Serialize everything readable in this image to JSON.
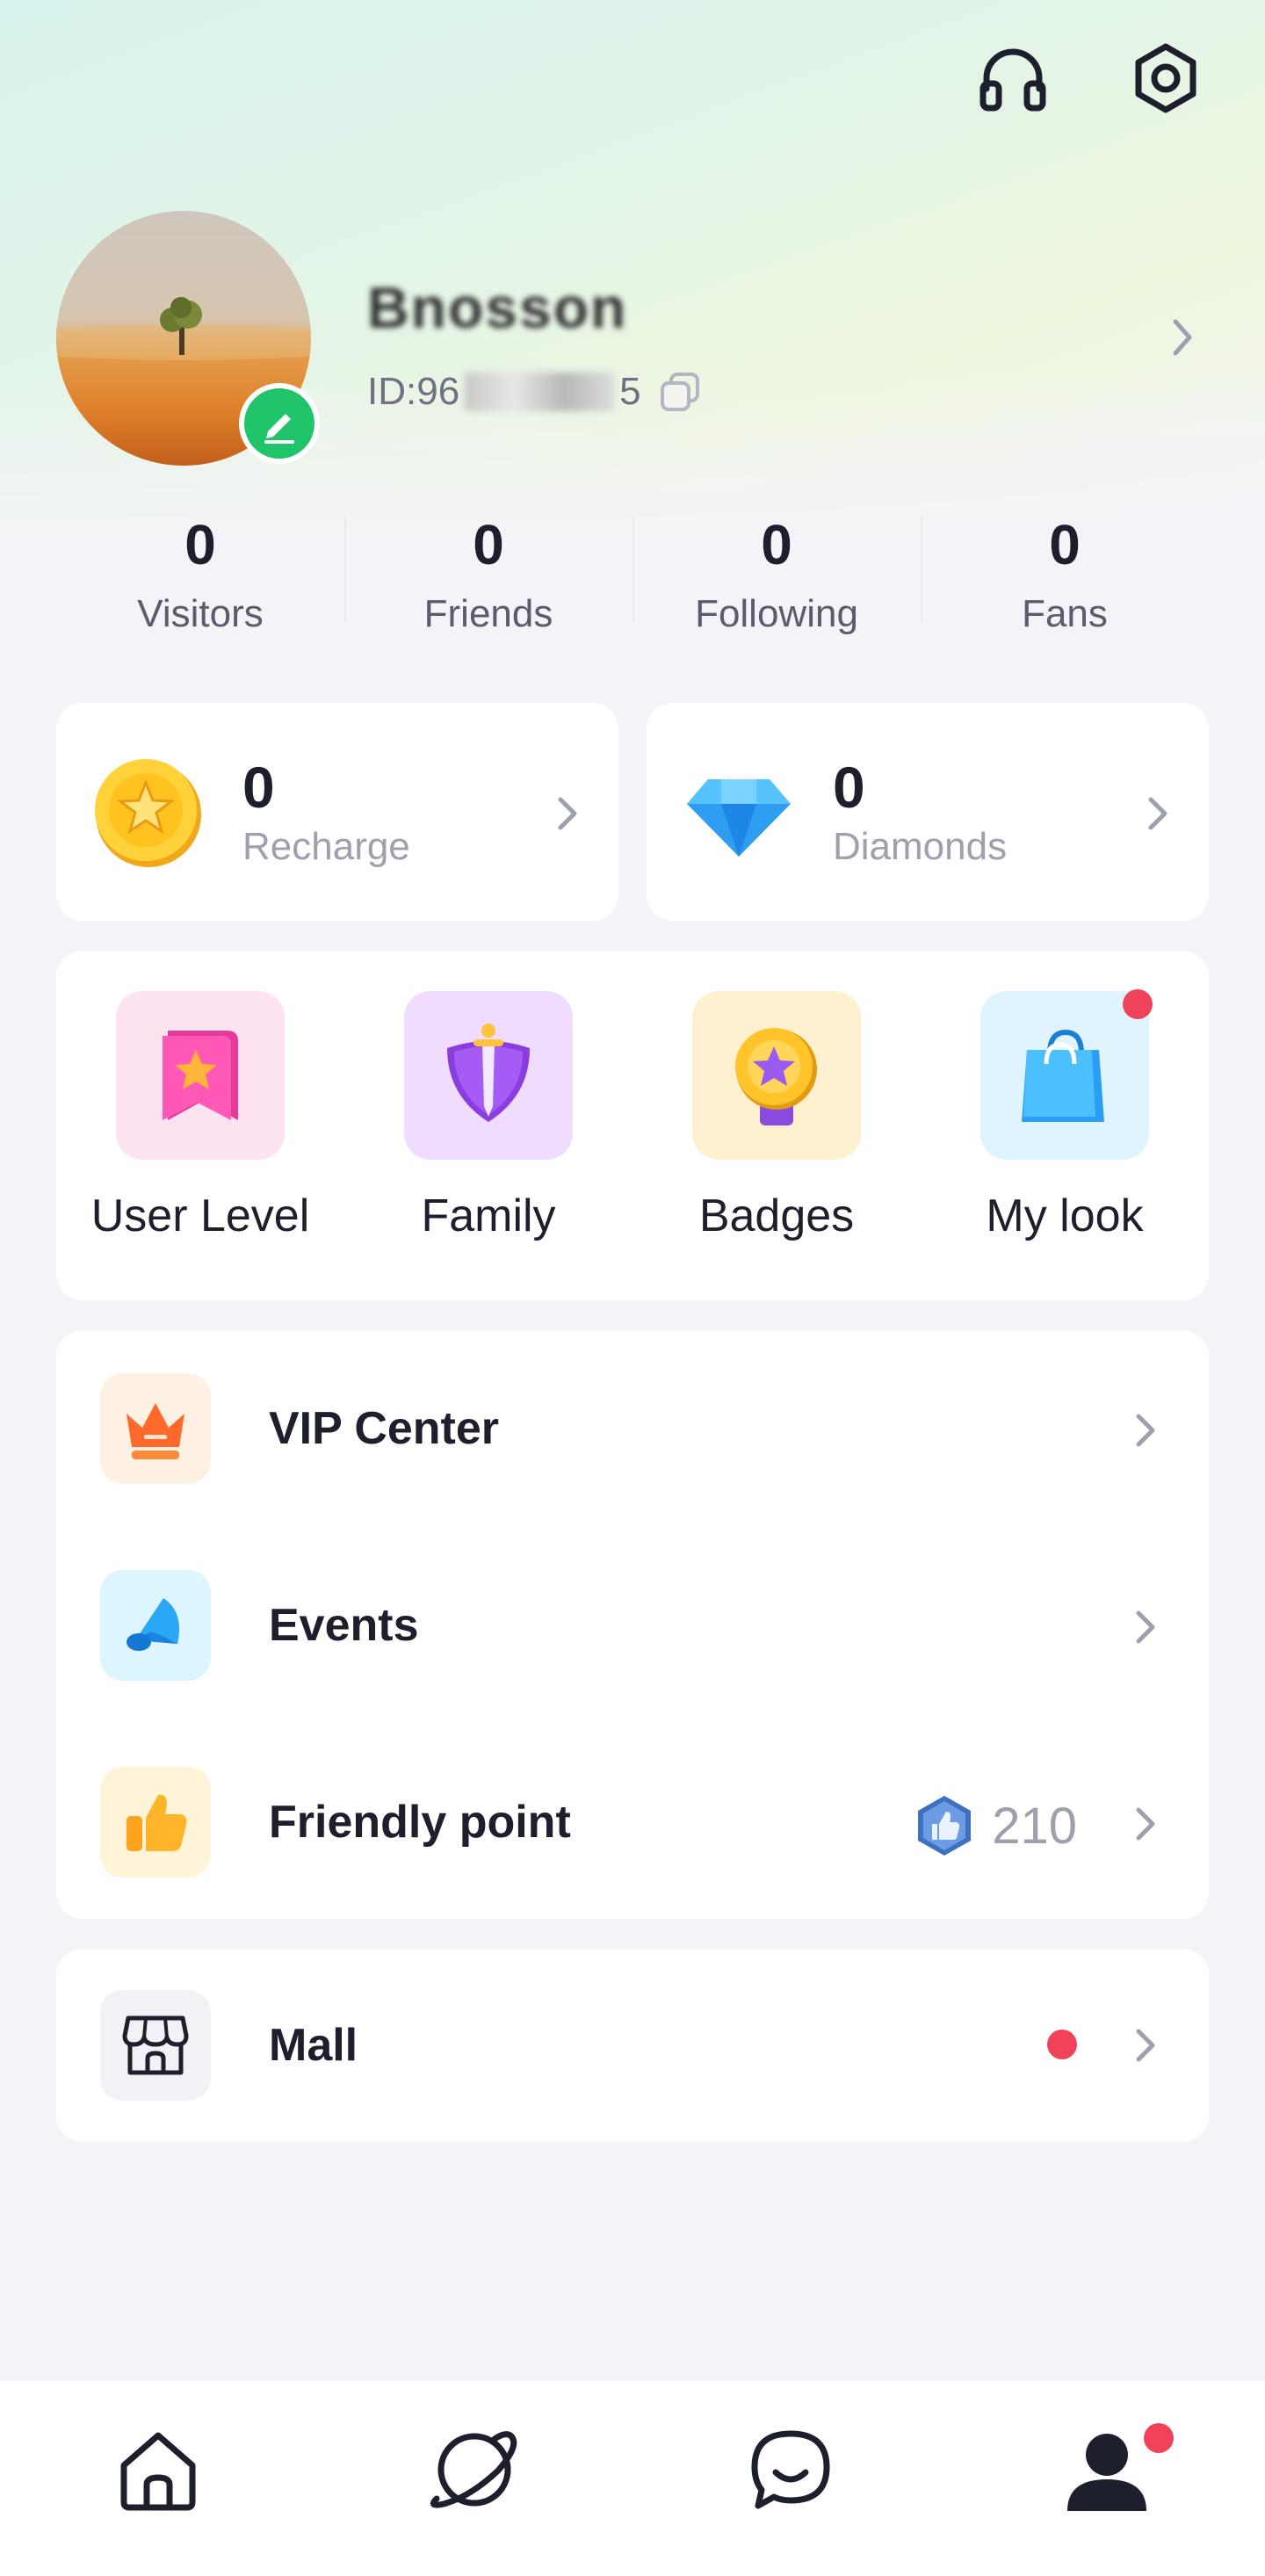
{
  "profile": {
    "username": "Bnosson",
    "id_prefix": "ID:96",
    "id_suffix": "5"
  },
  "stats": [
    {
      "value": "0",
      "label": "Visitors"
    },
    {
      "value": "0",
      "label": "Friends"
    },
    {
      "value": "0",
      "label": "Following"
    },
    {
      "value": "0",
      "label": "Fans"
    }
  ],
  "wallet": {
    "coins": {
      "value": "0",
      "label": "Recharge",
      "icon": "gold-coin-icon"
    },
    "diamonds": {
      "value": "0",
      "label": "Diamonds",
      "icon": "diamond-icon"
    }
  },
  "features": [
    {
      "label": "User Level",
      "icon": "level-flag-icon",
      "has_dot": false
    },
    {
      "label": "Family",
      "icon": "shield-sword-icon",
      "has_dot": false
    },
    {
      "label": "Badges",
      "icon": "medal-icon",
      "has_dot": false
    },
    {
      "label": "My look",
      "icon": "shopping-bag-icon",
      "has_dot": true
    }
  ],
  "menu": [
    {
      "label": "VIP Center",
      "icon": "crown-icon"
    },
    {
      "label": "Events",
      "icon": "megaphone-icon"
    },
    {
      "label": "Friendly point",
      "icon": "thumbs-up-icon",
      "value": "210"
    }
  ],
  "mall": {
    "label": "Mall",
    "icon": "storefront-icon",
    "has_dot": true
  },
  "bottom_nav": [
    {
      "name": "home",
      "icon": "home-icon",
      "active": false
    },
    {
      "name": "explore",
      "icon": "planet-icon",
      "active": false
    },
    {
      "name": "messages",
      "icon": "chat-icon",
      "active": false
    },
    {
      "name": "me",
      "icon": "user-icon",
      "active": true,
      "has_dot": true
    }
  ],
  "colors": {
    "accent_green": "#1fc46b",
    "notification_red": "#f0425a",
    "text_primary": "#1d1f2c",
    "text_secondary": "#9ea0ad"
  }
}
